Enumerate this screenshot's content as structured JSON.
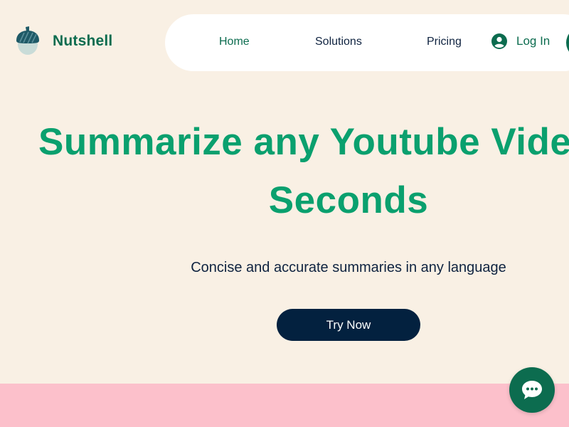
{
  "brand": {
    "name": "Nutshell",
    "logo_icon": "acorn-icon",
    "colors": {
      "brand_green": "#0c6c4f",
      "title_green": "#0aa06e",
      "navy": "#03213f",
      "background": "#f9f0e4",
      "pink": "#fcc0cb"
    }
  },
  "nav": {
    "items": [
      {
        "label": "Home",
        "active": true
      },
      {
        "label": "Solutions",
        "active": false
      },
      {
        "label": "Pricing",
        "active": false
      }
    ],
    "login_label": "Log In",
    "login_icon": "user-avatar-icon"
  },
  "hero": {
    "title_line1": "Summarize any Youtube Video in",
    "title_line2": "Seconds",
    "subtitle": "Concise and accurate summaries in any language",
    "cta_label": "Try Now"
  },
  "chat": {
    "icon": "chat-bubble-icon"
  }
}
